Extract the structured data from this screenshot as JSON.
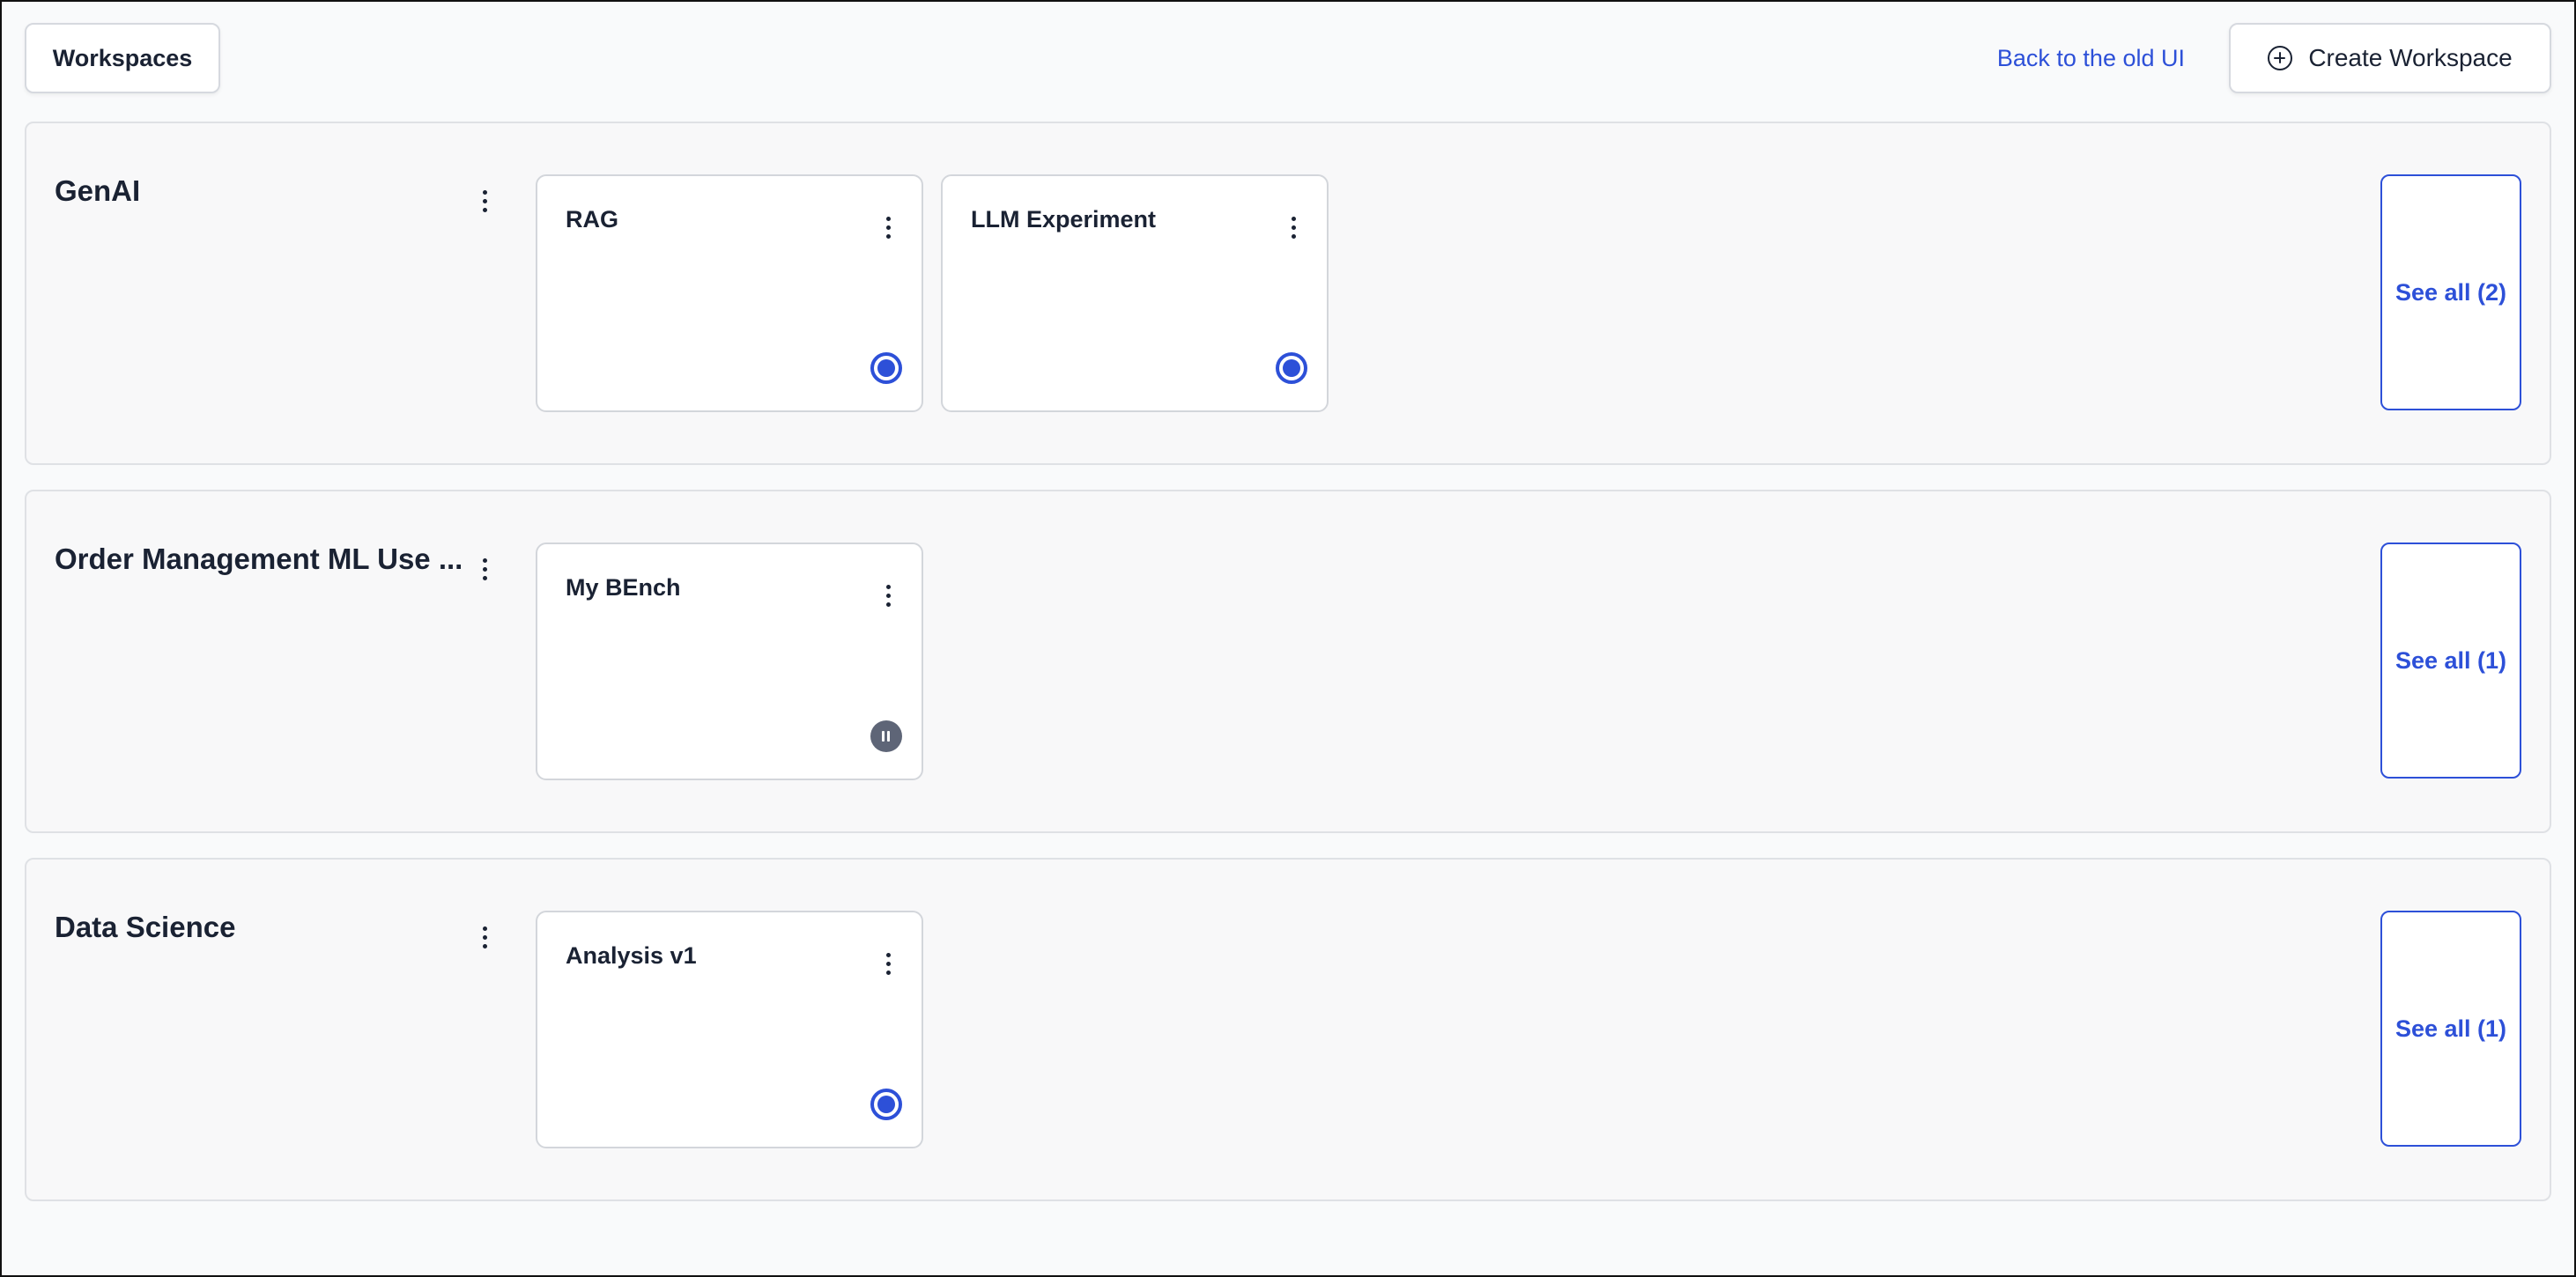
{
  "header": {
    "workspaces_label": "Workspaces",
    "back_link": "Back to the old UI",
    "create_label": "Create Workspace"
  },
  "colors": {
    "accent": "#2d50d8",
    "text": "#1a2233",
    "paused": "#5e6577"
  },
  "sections": [
    {
      "title": "GenAI",
      "see_all": "See all (2)",
      "cards": [
        {
          "title": "RAG",
          "status": "running"
        },
        {
          "title": "LLM Experiment",
          "status": "running"
        }
      ]
    },
    {
      "title": "Order Management ML Use ...",
      "see_all": "See all (1)",
      "cards": [
        {
          "title": "My BEnch",
          "status": "paused"
        }
      ]
    },
    {
      "title": "Data Science",
      "see_all": "See all (1)",
      "cards": [
        {
          "title": "Analysis v1",
          "status": "running"
        }
      ]
    }
  ]
}
